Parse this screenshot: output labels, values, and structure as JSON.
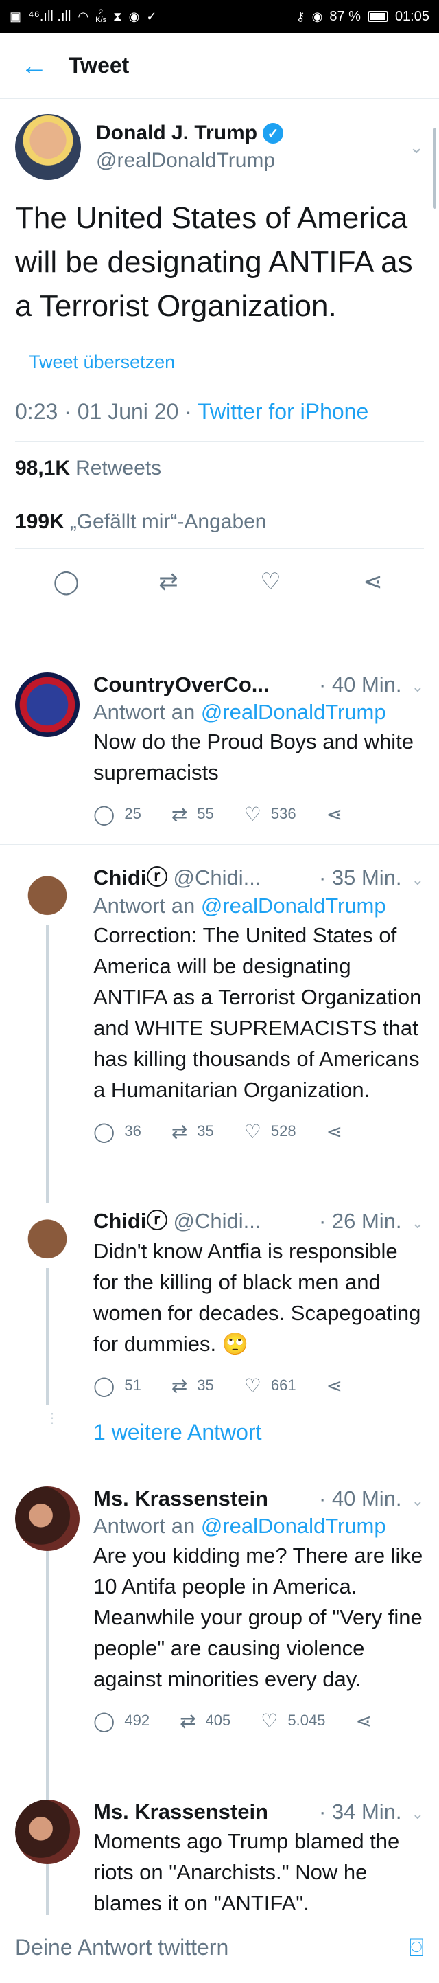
{
  "statusbar": {
    "left_text": "⁴⁶.ıll .ıll",
    "speed_top": "2",
    "speed_bottom": "K/s",
    "battery": "87 %",
    "time": "01:05"
  },
  "header": {
    "back_icon": "arrow-left-icon",
    "title": "Tweet"
  },
  "main_tweet": {
    "name": "Donald J. Trump",
    "handle": "@realDonaldTrump",
    "text": "The United States of America will be designating ANTIFA as a Terrorist Organization.",
    "translate": "Tweet übersetzen",
    "timestamp": "0:23 · 01 Juni 20 · ",
    "source": "Twitter for iPhone",
    "retweets_count": "98,1K",
    "retweets_label": "Retweets",
    "likes_count": "199K",
    "likes_label": "„Gefällt mir“-Angaben"
  },
  "replies": [
    {
      "name": "CountryOverCo...",
      "handle": "",
      "time": "· 40 Min.",
      "reply_to_prefix": "Antwort an ",
      "reply_to": "@realDonaldTrump",
      "text": "Now do the Proud Boys and white supremacists",
      "comments": "25",
      "retweets": "55",
      "likes": "536"
    },
    {
      "name": "Chidiⓡ",
      "handle": "@Chidi...",
      "time": "· 35 Min.",
      "reply_to_prefix": "Antwort an ",
      "reply_to": "@realDonaldTrump",
      "text": "Correction: The United States of America will be designating ANTIFA as a Terrorist Organization and WHITE SUPREMACISTS that has killing thousands of Americans a Humanitarian Organization.",
      "comments": "36",
      "retweets": "35",
      "likes": "528"
    },
    {
      "name": "Chidiⓡ",
      "handle": "@Chidi...",
      "time": "· 26 Min.",
      "text": "Didn't know Antfia is responsible for the killing of black men and women for decades. Scapegoating for dummies. 🙄",
      "comments": "51",
      "retweets": "35",
      "likes": "661",
      "more": "1 weitere Antwort"
    },
    {
      "name": "Ms. Krassenstein",
      "handle": "",
      "time": "· 40 Min.",
      "reply_to_prefix": "Antwort an ",
      "reply_to": "@realDonaldTrump",
      "text": "Are you kidding me?  There are like 10 Antifa people in America.  Meanwhile your group of \"Very fine people\" are causing violence against minorities every day.",
      "comments": "492",
      "retweets": "405",
      "likes": "5.045"
    },
    {
      "name": "Ms. Krassenstein",
      "handle": "",
      "time": "· 34 Min.",
      "text": "Moments ago Trump blamed the riots on \"Anarchists.\" Now he blames it on \"ANTIFA\"."
    }
  ],
  "compose": {
    "placeholder": "Deine Antwort twittern",
    "camera_icon": "camera-icon"
  },
  "colors": {
    "accent": "#1da1f2",
    "muted": "#657786",
    "border": "#e6ecf0"
  }
}
